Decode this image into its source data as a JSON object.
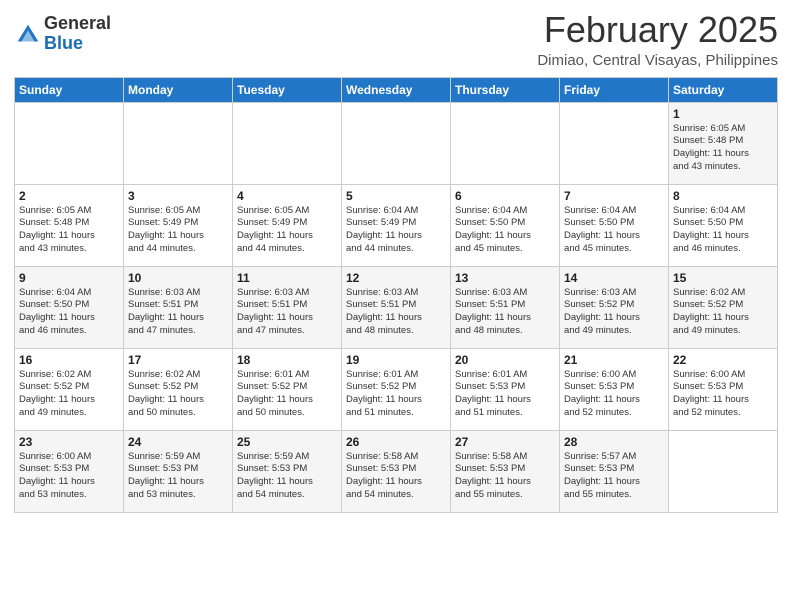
{
  "header": {
    "logo_general": "General",
    "logo_blue": "Blue",
    "month_title": "February 2025",
    "location": "Dimiao, Central Visayas, Philippines"
  },
  "weekdays": [
    "Sunday",
    "Monday",
    "Tuesday",
    "Wednesday",
    "Thursday",
    "Friday",
    "Saturday"
  ],
  "weeks": [
    [
      {
        "day": "",
        "info": ""
      },
      {
        "day": "",
        "info": ""
      },
      {
        "day": "",
        "info": ""
      },
      {
        "day": "",
        "info": ""
      },
      {
        "day": "",
        "info": ""
      },
      {
        "day": "",
        "info": ""
      },
      {
        "day": "1",
        "info": "Sunrise: 6:05 AM\nSunset: 5:48 PM\nDaylight: 11 hours\nand 43 minutes."
      }
    ],
    [
      {
        "day": "2",
        "info": "Sunrise: 6:05 AM\nSunset: 5:48 PM\nDaylight: 11 hours\nand 43 minutes."
      },
      {
        "day": "3",
        "info": "Sunrise: 6:05 AM\nSunset: 5:49 PM\nDaylight: 11 hours\nand 44 minutes."
      },
      {
        "day": "4",
        "info": "Sunrise: 6:05 AM\nSunset: 5:49 PM\nDaylight: 11 hours\nand 44 minutes."
      },
      {
        "day": "5",
        "info": "Sunrise: 6:04 AM\nSunset: 5:49 PM\nDaylight: 11 hours\nand 44 minutes."
      },
      {
        "day": "6",
        "info": "Sunrise: 6:04 AM\nSunset: 5:50 PM\nDaylight: 11 hours\nand 45 minutes."
      },
      {
        "day": "7",
        "info": "Sunrise: 6:04 AM\nSunset: 5:50 PM\nDaylight: 11 hours\nand 45 minutes."
      },
      {
        "day": "8",
        "info": "Sunrise: 6:04 AM\nSunset: 5:50 PM\nDaylight: 11 hours\nand 46 minutes."
      }
    ],
    [
      {
        "day": "9",
        "info": "Sunrise: 6:04 AM\nSunset: 5:50 PM\nDaylight: 11 hours\nand 46 minutes."
      },
      {
        "day": "10",
        "info": "Sunrise: 6:03 AM\nSunset: 5:51 PM\nDaylight: 11 hours\nand 47 minutes."
      },
      {
        "day": "11",
        "info": "Sunrise: 6:03 AM\nSunset: 5:51 PM\nDaylight: 11 hours\nand 47 minutes."
      },
      {
        "day": "12",
        "info": "Sunrise: 6:03 AM\nSunset: 5:51 PM\nDaylight: 11 hours\nand 48 minutes."
      },
      {
        "day": "13",
        "info": "Sunrise: 6:03 AM\nSunset: 5:51 PM\nDaylight: 11 hours\nand 48 minutes."
      },
      {
        "day": "14",
        "info": "Sunrise: 6:03 AM\nSunset: 5:52 PM\nDaylight: 11 hours\nand 49 minutes."
      },
      {
        "day": "15",
        "info": "Sunrise: 6:02 AM\nSunset: 5:52 PM\nDaylight: 11 hours\nand 49 minutes."
      }
    ],
    [
      {
        "day": "16",
        "info": "Sunrise: 6:02 AM\nSunset: 5:52 PM\nDaylight: 11 hours\nand 49 minutes."
      },
      {
        "day": "17",
        "info": "Sunrise: 6:02 AM\nSunset: 5:52 PM\nDaylight: 11 hours\nand 50 minutes."
      },
      {
        "day": "18",
        "info": "Sunrise: 6:01 AM\nSunset: 5:52 PM\nDaylight: 11 hours\nand 50 minutes."
      },
      {
        "day": "19",
        "info": "Sunrise: 6:01 AM\nSunset: 5:52 PM\nDaylight: 11 hours\nand 51 minutes."
      },
      {
        "day": "20",
        "info": "Sunrise: 6:01 AM\nSunset: 5:53 PM\nDaylight: 11 hours\nand 51 minutes."
      },
      {
        "day": "21",
        "info": "Sunrise: 6:00 AM\nSunset: 5:53 PM\nDaylight: 11 hours\nand 52 minutes."
      },
      {
        "day": "22",
        "info": "Sunrise: 6:00 AM\nSunset: 5:53 PM\nDaylight: 11 hours\nand 52 minutes."
      }
    ],
    [
      {
        "day": "23",
        "info": "Sunrise: 6:00 AM\nSunset: 5:53 PM\nDaylight: 11 hours\nand 53 minutes."
      },
      {
        "day": "24",
        "info": "Sunrise: 5:59 AM\nSunset: 5:53 PM\nDaylight: 11 hours\nand 53 minutes."
      },
      {
        "day": "25",
        "info": "Sunrise: 5:59 AM\nSunset: 5:53 PM\nDaylight: 11 hours\nand 54 minutes."
      },
      {
        "day": "26",
        "info": "Sunrise: 5:58 AM\nSunset: 5:53 PM\nDaylight: 11 hours\nand 54 minutes."
      },
      {
        "day": "27",
        "info": "Sunrise: 5:58 AM\nSunset: 5:53 PM\nDaylight: 11 hours\nand 55 minutes."
      },
      {
        "day": "28",
        "info": "Sunrise: 5:57 AM\nSunset: 5:53 PM\nDaylight: 11 hours\nand 55 minutes."
      },
      {
        "day": "",
        "info": ""
      }
    ]
  ]
}
